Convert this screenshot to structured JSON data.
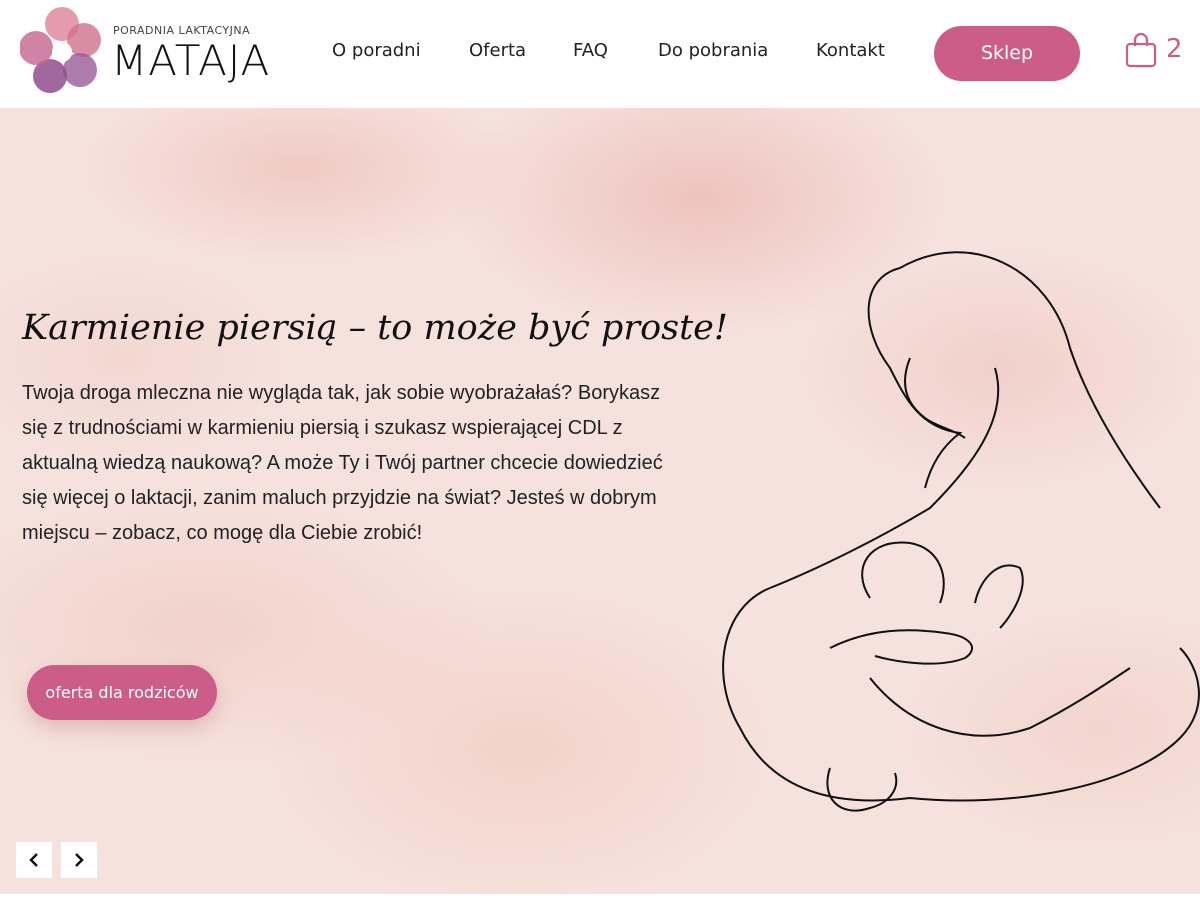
{
  "header": {
    "logo_subtitle": "PORADNIA LAKTACYJNA",
    "logo_name": "MATAJA",
    "nav": [
      "O poradni",
      "Oferta",
      "FAQ",
      "Do pobrania",
      "Kontakt"
    ],
    "shop_label": "Sklep",
    "cart_icon": "shopping-bag-icon",
    "cart_count": "2"
  },
  "hero": {
    "title": "Karmienie piersią –  to może być proste!",
    "text": "Twoja droga mleczna nie wygląda tak, jak sobie wyobrażałaś? Borykasz się z trudnościami w karmieniu piersią i szukasz wspierającej CDL z aktualną wiedzą naukową? A może Ty i Twój partner chcecie dowiedzieć się więcej o laktacji, zanim maluch przyjdzie na świat? Jesteś w dobrym miejscu – zobacz, co mogę dla Ciebie zrobić!",
    "button_label": "oferta dla rodziców",
    "prev_icon": "chevron-left-icon",
    "next_icon": "chevron-right-icon"
  },
  "colors": {
    "accent": "#cc5d88",
    "background": "#f6e2dd"
  }
}
